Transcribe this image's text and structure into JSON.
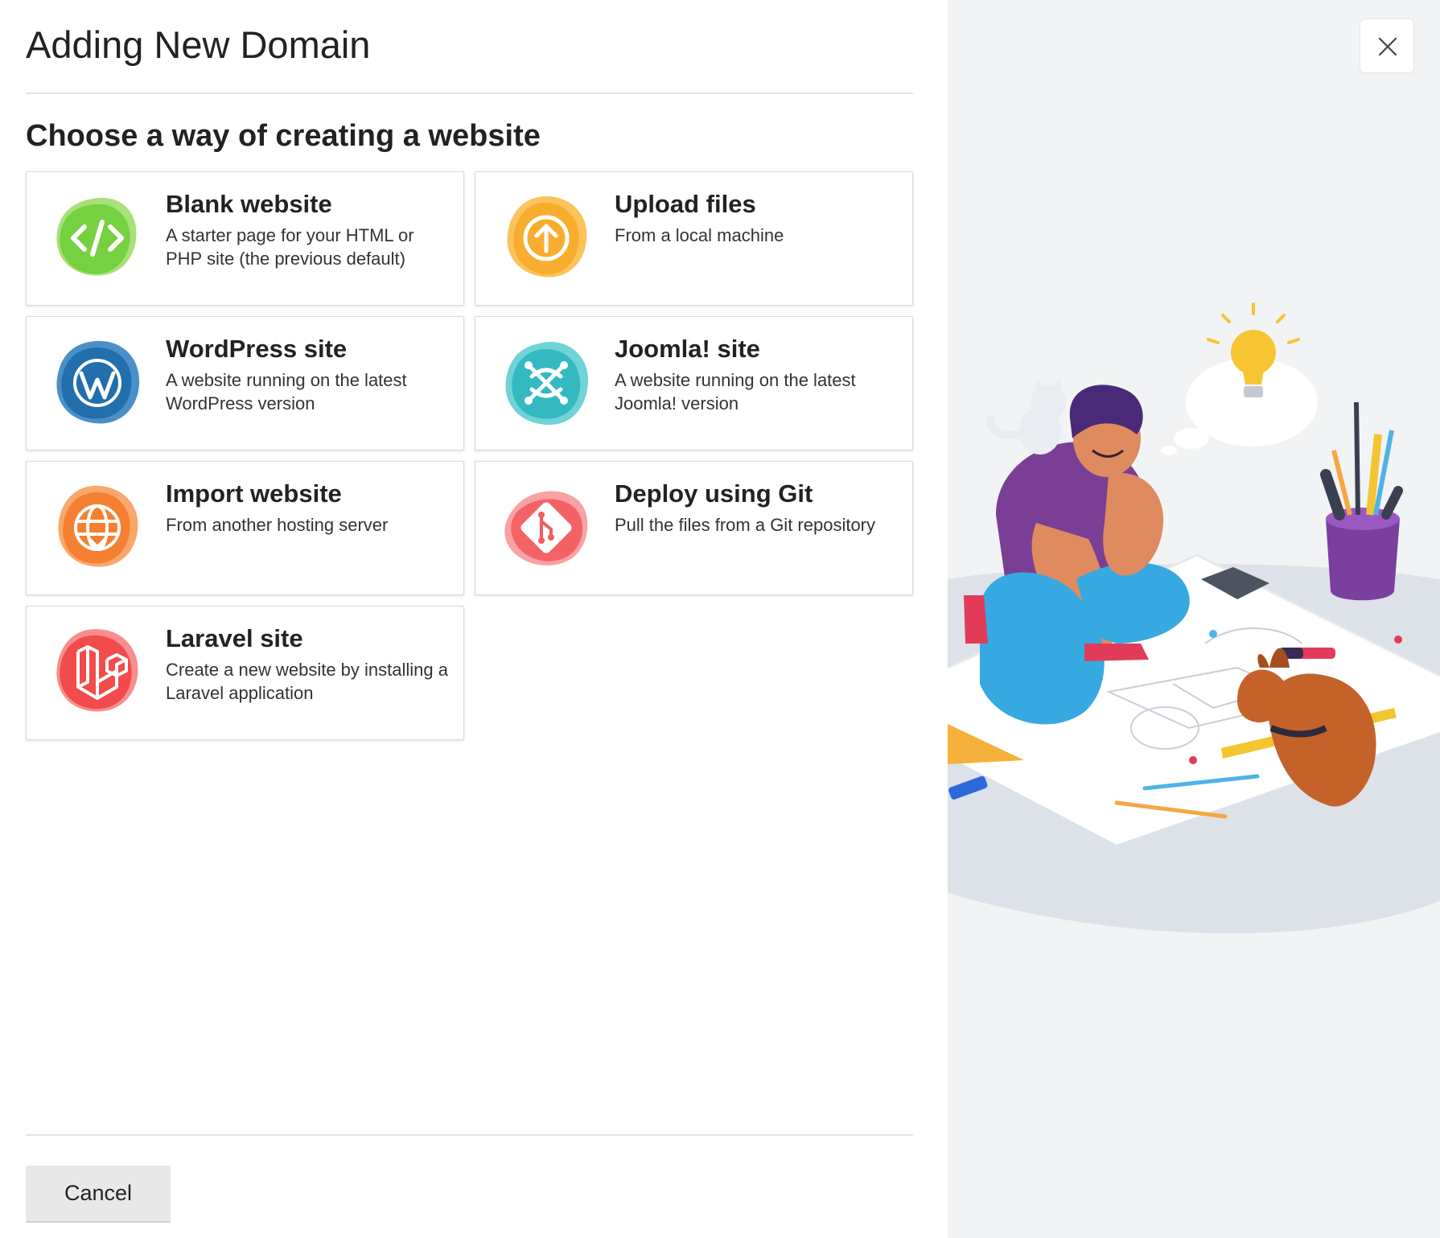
{
  "dialog": {
    "title": "Adding New Domain",
    "subtitle": "Choose a way of creating a website",
    "cancel_label": "Cancel"
  },
  "options": [
    {
      "title": "Blank website",
      "description": "A starter page for your HTML or PHP site (the previous default)",
      "icon": "code-icon",
      "color": "#7ed957"
    },
    {
      "title": "Upload files",
      "description": "From a local machine",
      "icon": "upload-icon",
      "color": "#f9b233"
    },
    {
      "title": "WordPress site",
      "description": "A website running on the latest WordPress version",
      "icon": "wordpress-icon",
      "color": "#2a79b8"
    },
    {
      "title": "Joomla! site",
      "description": "A website running on the latest Joomla! version",
      "icon": "joomla-icon",
      "color": "#3dbfc6"
    },
    {
      "title": "Import website",
      "description": "From another hosting server",
      "icon": "globe-import-icon",
      "color": "#f58a3c"
    },
    {
      "title": "Deploy using Git",
      "description": "Pull the files from a Git repository",
      "icon": "git-icon",
      "color": "#f1585a"
    },
    {
      "title": "Laravel site",
      "description": "Create a new website by installing a Laravel application",
      "icon": "laravel-icon",
      "color": "#f04c4c"
    }
  ]
}
